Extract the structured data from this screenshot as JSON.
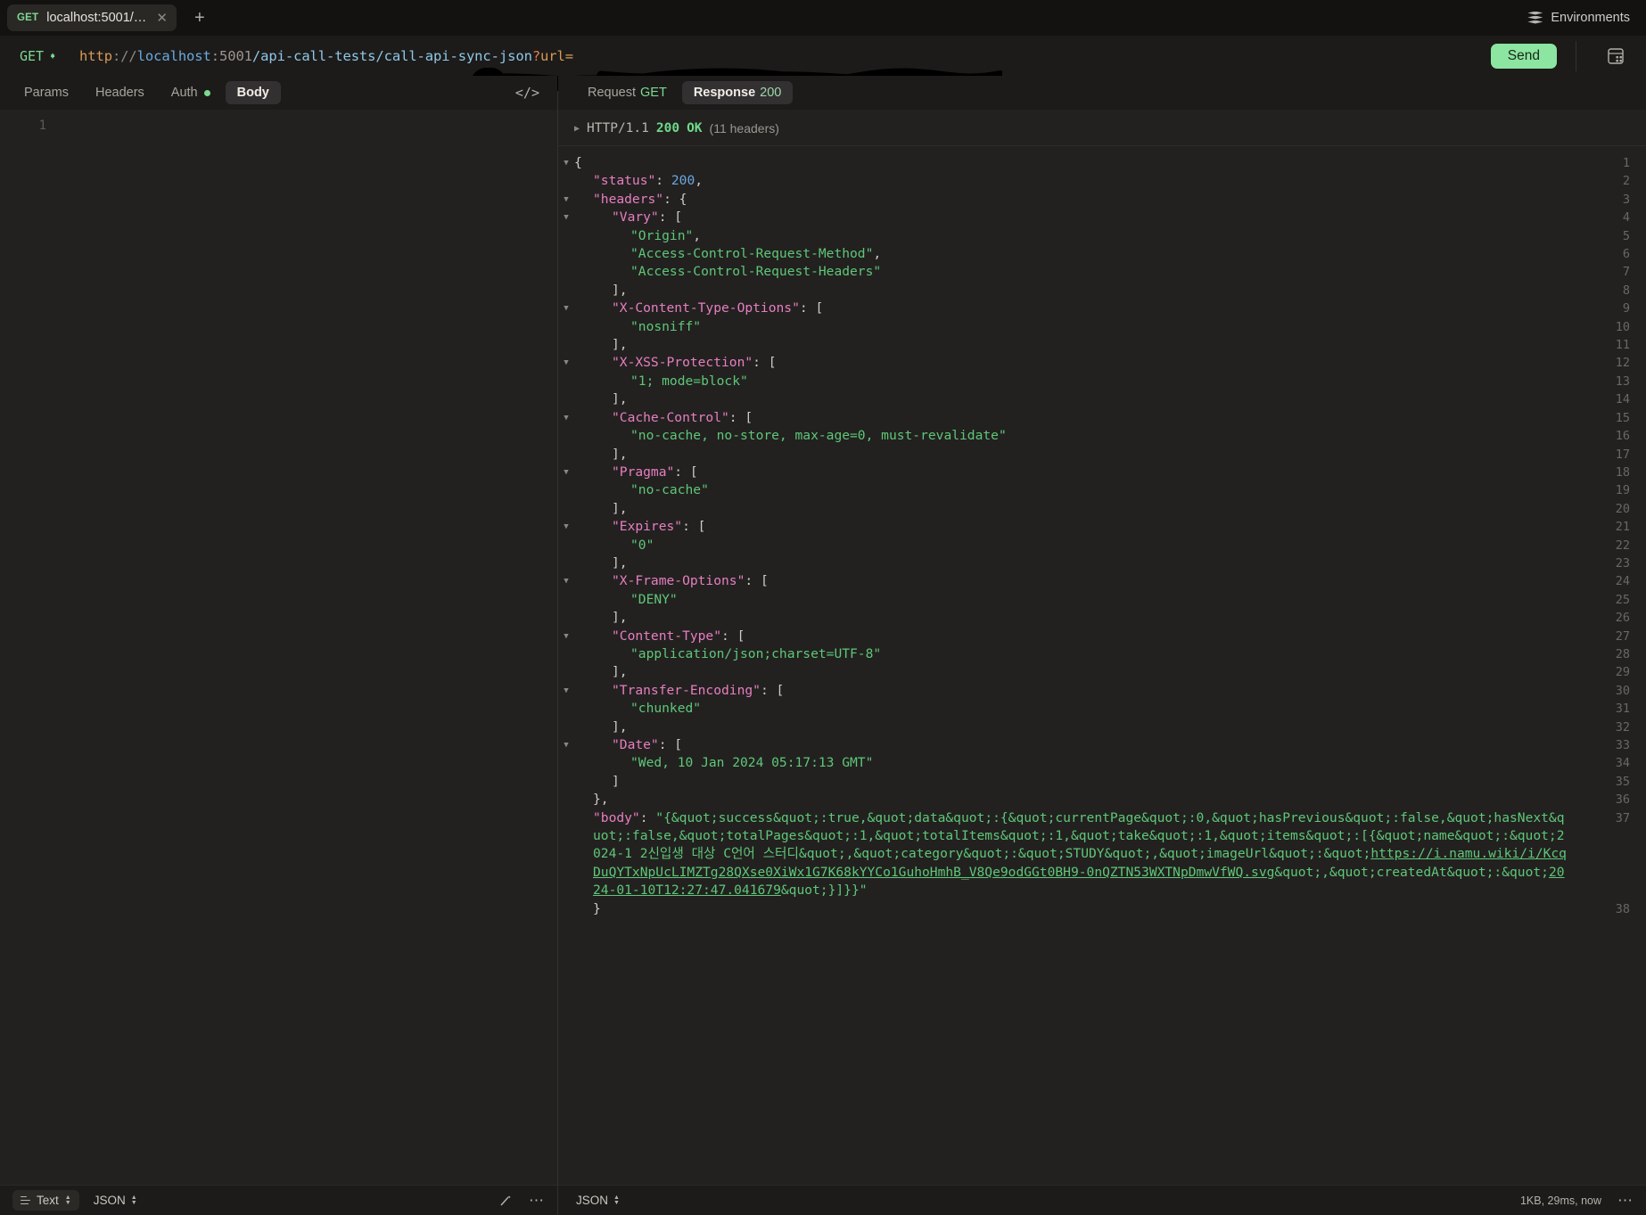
{
  "window": {
    "tab": {
      "method": "GET",
      "title": "localhost:5001/api-cal...",
      "close_icon": "close-icon"
    },
    "new_tab_label": "+",
    "environments_label": "Environments"
  },
  "url_bar": {
    "method": "GET",
    "scheme": "http",
    "separator": "://",
    "host": "localhost",
    "port": ":5001",
    "path": "/api-call-tests/call-api-sync-json",
    "query_start": "?",
    "param": "url=",
    "redacted": true,
    "send_label": "Send",
    "code_gen_icon": "code-generate-icon"
  },
  "request_pane": {
    "tabs": [
      {
        "label": "Params",
        "active": false
      },
      {
        "label": "Headers",
        "active": false
      },
      {
        "label": "Auth",
        "active": false,
        "dot": true
      },
      {
        "label": "Body",
        "active": true
      }
    ],
    "code_icon": "code-brackets-icon",
    "editor_line_number": "1",
    "footer": {
      "format_label": "Text",
      "lang_label": "JSON",
      "beautify_icon": "magic-wand-icon",
      "more_icon": "more-options-icon"
    }
  },
  "response_pane": {
    "tabs": [
      {
        "label": "Request",
        "sub": "GET",
        "sub_kind": "green",
        "active": false
      },
      {
        "label": "Response",
        "sub": "200",
        "sub_kind": "gray",
        "active": true
      }
    ],
    "status_line": {
      "protocol": "HTTP/1.1",
      "code": "200",
      "text": "OK",
      "headers_count": "(11 headers)"
    },
    "footer": {
      "lang_label": "JSON",
      "meta": "1KB, 29ms, now",
      "more_icon": "more-options-icon"
    }
  },
  "json_lines": [
    {
      "n": "1",
      "caret": "down",
      "indent": 0,
      "parts": [
        {
          "t": "p",
          "v": "{"
        }
      ]
    },
    {
      "n": "2",
      "caret": "",
      "indent": 1,
      "parts": [
        {
          "t": "k",
          "v": "\"status\""
        },
        {
          "t": "p",
          "v": ": "
        },
        {
          "t": "n",
          "v": "200"
        },
        {
          "t": "p",
          "v": ","
        }
      ]
    },
    {
      "n": "3",
      "caret": "down",
      "indent": 1,
      "parts": [
        {
          "t": "k",
          "v": "\"headers\""
        },
        {
          "t": "p",
          "v": ": {"
        }
      ]
    },
    {
      "n": "4",
      "caret": "down",
      "indent": 2,
      "parts": [
        {
          "t": "k",
          "v": "\"Vary\""
        },
        {
          "t": "p",
          "v": ": ["
        }
      ]
    },
    {
      "n": "5",
      "caret": "",
      "indent": 3,
      "parts": [
        {
          "t": "s",
          "v": "\"Origin\""
        },
        {
          "t": "p",
          "v": ","
        }
      ]
    },
    {
      "n": "6",
      "caret": "",
      "indent": 3,
      "parts": [
        {
          "t": "s",
          "v": "\"Access-Control-Request-Method\""
        },
        {
          "t": "p",
          "v": ","
        }
      ]
    },
    {
      "n": "7",
      "caret": "",
      "indent": 3,
      "parts": [
        {
          "t": "s",
          "v": "\"Access-Control-Request-Headers\""
        }
      ]
    },
    {
      "n": "8",
      "caret": "",
      "indent": 2,
      "parts": [
        {
          "t": "p",
          "v": "],"
        }
      ]
    },
    {
      "n": "9",
      "caret": "down",
      "indent": 2,
      "parts": [
        {
          "t": "k",
          "v": "\"X-Content-Type-Options\""
        },
        {
          "t": "p",
          "v": ": ["
        }
      ]
    },
    {
      "n": "10",
      "caret": "",
      "indent": 3,
      "parts": [
        {
          "t": "s",
          "v": "\"nosniff\""
        }
      ]
    },
    {
      "n": "11",
      "caret": "",
      "indent": 2,
      "parts": [
        {
          "t": "p",
          "v": "],"
        }
      ]
    },
    {
      "n": "12",
      "caret": "down",
      "indent": 2,
      "parts": [
        {
          "t": "k",
          "v": "\"X-XSS-Protection\""
        },
        {
          "t": "p",
          "v": ": ["
        }
      ]
    },
    {
      "n": "13",
      "caret": "",
      "indent": 3,
      "parts": [
        {
          "t": "s",
          "v": "\"1; mode=block\""
        }
      ]
    },
    {
      "n": "14",
      "caret": "",
      "indent": 2,
      "parts": [
        {
          "t": "p",
          "v": "],"
        }
      ]
    },
    {
      "n": "15",
      "caret": "down",
      "indent": 2,
      "parts": [
        {
          "t": "k",
          "v": "\"Cache-Control\""
        },
        {
          "t": "p",
          "v": ": ["
        }
      ]
    },
    {
      "n": "16",
      "caret": "",
      "indent": 3,
      "parts": [
        {
          "t": "s",
          "v": "\"no-cache, no-store, max-age=0, must-revalidate\""
        }
      ]
    },
    {
      "n": "17",
      "caret": "",
      "indent": 2,
      "parts": [
        {
          "t": "p",
          "v": "],"
        }
      ]
    },
    {
      "n": "18",
      "caret": "down",
      "indent": 2,
      "parts": [
        {
          "t": "k",
          "v": "\"Pragma\""
        },
        {
          "t": "p",
          "v": ": ["
        }
      ]
    },
    {
      "n": "19",
      "caret": "",
      "indent": 3,
      "parts": [
        {
          "t": "s",
          "v": "\"no-cache\""
        }
      ]
    },
    {
      "n": "20",
      "caret": "",
      "indent": 2,
      "parts": [
        {
          "t": "p",
          "v": "],"
        }
      ]
    },
    {
      "n": "21",
      "caret": "down",
      "indent": 2,
      "parts": [
        {
          "t": "k",
          "v": "\"Expires\""
        },
        {
          "t": "p",
          "v": ": ["
        }
      ]
    },
    {
      "n": "22",
      "caret": "",
      "indent": 3,
      "parts": [
        {
          "t": "s",
          "v": "\"0\""
        }
      ]
    },
    {
      "n": "23",
      "caret": "",
      "indent": 2,
      "parts": [
        {
          "t": "p",
          "v": "],"
        }
      ]
    },
    {
      "n": "24",
      "caret": "down",
      "indent": 2,
      "parts": [
        {
          "t": "k",
          "v": "\"X-Frame-Options\""
        },
        {
          "t": "p",
          "v": ": ["
        }
      ]
    },
    {
      "n": "25",
      "caret": "",
      "indent": 3,
      "parts": [
        {
          "t": "s",
          "v": "\"DENY\""
        }
      ]
    },
    {
      "n": "26",
      "caret": "",
      "indent": 2,
      "parts": [
        {
          "t": "p",
          "v": "],"
        }
      ]
    },
    {
      "n": "27",
      "caret": "down",
      "indent": 2,
      "parts": [
        {
          "t": "k",
          "v": "\"Content-Type\""
        },
        {
          "t": "p",
          "v": ": ["
        }
      ]
    },
    {
      "n": "28",
      "caret": "",
      "indent": 3,
      "parts": [
        {
          "t": "s",
          "v": "\"application/json;charset=UTF-8\""
        }
      ]
    },
    {
      "n": "29",
      "caret": "",
      "indent": 2,
      "parts": [
        {
          "t": "p",
          "v": "],"
        }
      ]
    },
    {
      "n": "30",
      "caret": "down",
      "indent": 2,
      "parts": [
        {
          "t": "k",
          "v": "\"Transfer-Encoding\""
        },
        {
          "t": "p",
          "v": ": ["
        }
      ]
    },
    {
      "n": "31",
      "caret": "",
      "indent": 3,
      "parts": [
        {
          "t": "s",
          "v": "\"chunked\""
        }
      ]
    },
    {
      "n": "32",
      "caret": "",
      "indent": 2,
      "parts": [
        {
          "t": "p",
          "v": "],"
        }
      ]
    },
    {
      "n": "33",
      "caret": "down",
      "indent": 2,
      "parts": [
        {
          "t": "k",
          "v": "\"Date\""
        },
        {
          "t": "p",
          "v": ": ["
        }
      ]
    },
    {
      "n": "34",
      "caret": "",
      "indent": 3,
      "parts": [
        {
          "t": "s",
          "v": "\"Wed, 10 Jan 2024 05:17:13 GMT\""
        }
      ]
    },
    {
      "n": "35",
      "caret": "",
      "indent": 2,
      "parts": [
        {
          "t": "p",
          "v": "]"
        }
      ]
    },
    {
      "n": "36",
      "caret": "",
      "indent": 1,
      "parts": [
        {
          "t": "p",
          "v": "},"
        }
      ]
    },
    {
      "n": "37",
      "caret": "",
      "indent": 1,
      "wrap": true,
      "parts": [
        {
          "t": "k",
          "v": "\"body\""
        },
        {
          "t": "p",
          "v": ": "
        },
        {
          "t": "s",
          "v": "\"{&quot;success&quot;:true,&quot;data&quot;:{&quot;currentPage&quot;:0,&quot;hasPrevious&quot;:false,&quot;hasNext&quot;:false,&quot;totalPages&quot;:1,&quot;totalItems&quot;:1,&quot;take&quot;:1,&quot;items&quot;:[{&quot;name&quot;:&quot;2024-1 2신입생 대상 C언어 스터디&quot;,&quot;category&quot;:&quot;STUDY&quot;,&quot;imageUrl&quot;:&quot;"
        },
        {
          "t": "lnk",
          "v": "https://i.namu.wiki/i/KcqDuQYTxNpUcLIMZTg28QXse0XiWx1G7K68kYYCo1GuhoHmhB_V8Qe9odGGt0BH9-0nQZTN53WXTNpDmwVfWQ.svg"
        },
        {
          "t": "s",
          "v": "&quot;,&quot;createdAt&quot;:&quot;"
        },
        {
          "t": "lnk",
          "v": "2024-01-10T12:27:47.041679"
        },
        {
          "t": "s",
          "v": "&quot;}]}}\""
        }
      ]
    },
    {
      "n": "38",
      "caret": "",
      "indent": 1,
      "parts": [
        {
          "t": "p",
          "v": "}"
        }
      ]
    }
  ]
}
